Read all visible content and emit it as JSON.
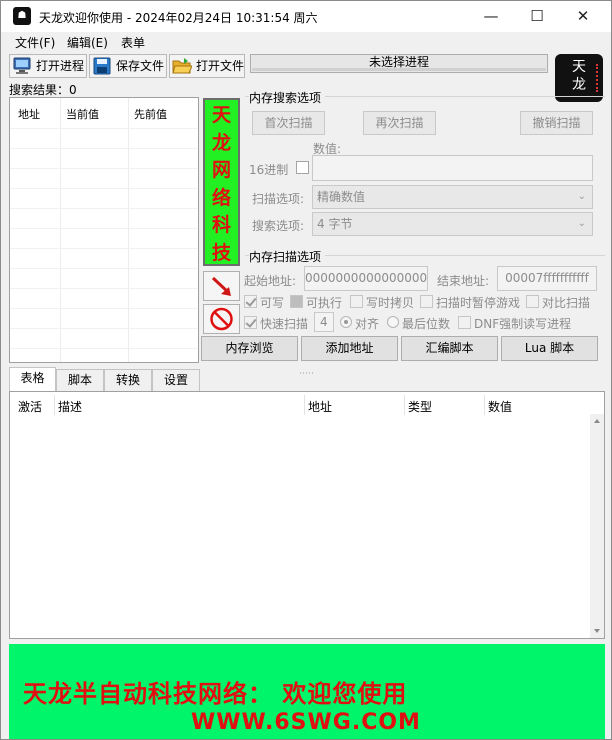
{
  "window": {
    "title": "天龙欢迎你使用  - 2024年02月24日 10:31:54 周六",
    "minimize_glyph": "—",
    "maximize_glyph": "☐",
    "close_glyph": "✕"
  },
  "app_icon": {
    "glyph": "☗",
    "icon": "app-logo-icon"
  },
  "menu": {
    "items": [
      "文件(F)",
      "编辑(E)",
      "表单"
    ]
  },
  "toolbar": {
    "open_process": "打开进程",
    "save_file": "保存文件",
    "open_file": "打开文件"
  },
  "process": {
    "label": "未选择进程"
  },
  "logo": {
    "line1": "天",
    "line2": "龙"
  },
  "search_results": {
    "label": "搜索结果：0",
    "columns": [
      "地址",
      "当前值",
      "先前值"
    ]
  },
  "vertical_banner": {
    "chars": [
      "天",
      "龙",
      "网",
      "络",
      "科",
      "技"
    ],
    "bg": "#22f022",
    "fg": "#e01010"
  },
  "scan": {
    "group_title": "内存搜索选项",
    "first_scan": "首次扫描",
    "next_scan": "再次扫描",
    "undo_scan": "撤销扫描",
    "value_label": "数值:",
    "hex_label": "16进制",
    "scan_option_label": "扫描选项:",
    "scan_option_value": "精确数值",
    "search_option_label": "搜索选项:",
    "search_option_value": "4 字节"
  },
  "mem_scan": {
    "group_title": "内存扫描选项",
    "start_label": "起始地址:",
    "start_value": "0000000000000000",
    "end_label": "结束地址:",
    "end_value": "00007fffffffffff",
    "writable": "可写",
    "executable": "可执行",
    "copy_on_write": "写时拷贝",
    "pause_game": "扫描时暂停游戏",
    "compare_scan": "对比扫描",
    "fast_scan": "快速扫描",
    "fast_scan_value": "4",
    "align": "对齐",
    "last_digits": "最后位数",
    "dnf_force": "DNF强制读写进程"
  },
  "buttons": {
    "memory_browse": "内存浏览",
    "add_address": "添加地址",
    "assemble_script": "汇编脚本",
    "lua_script": "Lua 脚本"
  },
  "tabs": [
    "表格",
    "脚本",
    "转换",
    "设置"
  ],
  "address_list": {
    "columns": [
      "激活",
      "描述",
      "地址",
      "类型",
      "数值"
    ]
  },
  "footer": {
    "line1": "天龙半自动科技网络：  欢迎您使用",
    "line2": "WWW.6SWG.COM",
    "bg": "#00f56a",
    "fg": "#e01010"
  }
}
